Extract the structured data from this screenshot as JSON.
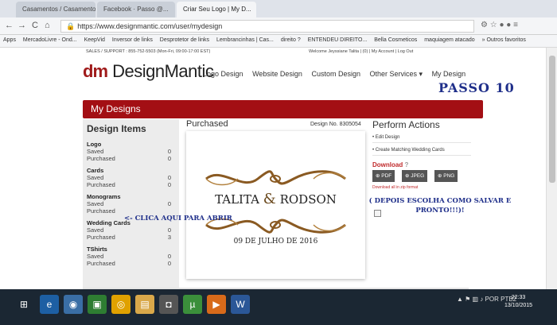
{
  "browser": {
    "tabs": [
      {
        "label": "Casamentos / Casamento ...",
        "active": false
      },
      {
        "label": "Facebook · Passo @...",
        "active": false
      },
      {
        "label": "Criar Seu Logo | My D...",
        "active": true
      }
    ],
    "url": "https://www.designmantic.com/user/mydesign",
    "nav_back": "←",
    "nav_forward": "→",
    "nav_reload": "C",
    "nav_home": "⌂",
    "toolbar_icons": "⚙ ☆ ● ● ≡",
    "bookmarks": [
      "Apps",
      "MercadoLivre - Ond...",
      "KeepVid",
      "Inversor de links",
      "Desprotetor de links",
      "Lembrancinhas | Cas...",
      "direito ?",
      "ENTENDEU DIREITO...",
      "Bella Cosmeticos",
      "maquiagem atacado"
    ],
    "bookmarks_more": "» Outros favoritos"
  },
  "site": {
    "top_left": "SALES / SUPPORT : 855-752-5503 (Mon-Fri, 09:00-17:00 EST)",
    "top_right": "Welcome Jeyssiane Talita  |  (0)  | My Account | Log Out",
    "logo_mark": "dm",
    "logo_name": "DesignMantic",
    "nav": [
      "Logo Design",
      "Website Design",
      "Custom Design",
      "Other Services ▾",
      "My Design"
    ],
    "page_title": "My Designs"
  },
  "annotations": {
    "passo": "PASSO   10",
    "clica": "<- CLICA AQUI PARA ABRIR",
    "note": "( DEPOIS ESCOLHA COMO SALVAR E PRONTO!!!)!"
  },
  "sidebar": {
    "heading": "Design Items",
    "categories": [
      {
        "title": "Logo",
        "saved_label": "Saved",
        "saved": "0",
        "purchased_label": "Purchased",
        "purchased": "0"
      },
      {
        "title": "Cards",
        "saved_label": "Saved",
        "saved": "0",
        "purchased_label": "Purchased",
        "purchased": "0"
      },
      {
        "title": "Monograms",
        "saved_label": "Saved",
        "saved": "0",
        "purchased_label": "Purchased",
        "purchased": ""
      },
      {
        "title": "Wedding Cards",
        "saved_label": "Saved",
        "saved": "0",
        "purchased_label": "Purchased",
        "purchased": "3"
      },
      {
        "title": "TShirts",
        "saved_label": "Saved",
        "saved": "0",
        "purchased_label": "Purchased",
        "purchased": "0"
      }
    ]
  },
  "design": {
    "section": "Purchased",
    "design_no": "Design No. 8305054",
    "name1": "TALITA",
    "amp": "&",
    "name2": "RODSON",
    "date": "09 DE JULHO DE 2016"
  },
  "perform": {
    "heading": "Perform Actions",
    "links": [
      "• Edit Design",
      "• Create Matching Wedding Cards"
    ],
    "download_label": "Download",
    "buttons": [
      "PDF",
      "JPEG",
      "PNG"
    ],
    "zip_link": "Download all in zip format"
  },
  "taskbar": {
    "time": "22:33",
    "date": "13/10/2015",
    "lang": "POR PTB2"
  }
}
